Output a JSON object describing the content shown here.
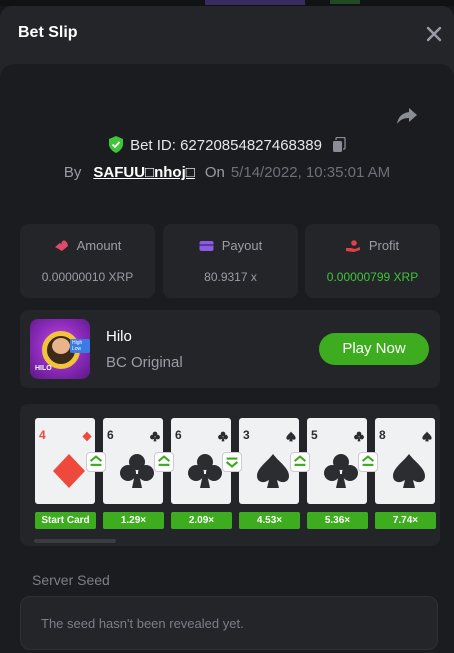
{
  "header": {
    "title": "Bet Slip"
  },
  "icons": {
    "close": "close-icon",
    "share": "share-icon",
    "verified": "shield-check-icon",
    "copy": "copy-icon"
  },
  "bet": {
    "id_label": "Bet ID:",
    "id": "62720854827468389",
    "by_label": "By",
    "user": "SAFUU□nhoj□",
    "on_label": "On",
    "date": "5/14/2022, 10:35:01 AM"
  },
  "stats": {
    "amount_label": "Amount",
    "amount_value": "0.00000010 XRP",
    "payout_label": "Payout",
    "payout_value": "80.9317 x",
    "profit_label": "Profit",
    "profit_value": "0.00000799 XRP"
  },
  "game": {
    "name": "Hilo",
    "provider": "BC Original",
    "play_label": "Play Now",
    "thumb_text": "HILO",
    "thumb_tag": "High Low"
  },
  "cards": [
    {
      "rank": "4",
      "suit": "diamond",
      "color": "red"
    },
    {
      "rank": "6",
      "suit": "club",
      "color": "black"
    },
    {
      "rank": "6",
      "suit": "club",
      "color": "black"
    },
    {
      "rank": "3",
      "suit": "spade",
      "color": "black"
    },
    {
      "rank": "5",
      "suit": "club",
      "color": "black"
    },
    {
      "rank": "8",
      "suit": "spade",
      "color": "black"
    }
  ],
  "guesses": [
    "higher-or-same",
    "higher-or-same",
    "lower-or-same",
    "higher-or-same",
    "higher-or-same"
  ],
  "multipliers": [
    "Start Card",
    "1.29×",
    "2.09×",
    "4.53×",
    "5.36×",
    "7.74×"
  ],
  "seed": {
    "label": "Server Seed",
    "message": "The seed hasn't been revealed yet."
  },
  "colors": {
    "accent": "#3dad1f",
    "profit": "#3fc43a",
    "diamond": "#ee4a3b",
    "background": "#17181b"
  }
}
